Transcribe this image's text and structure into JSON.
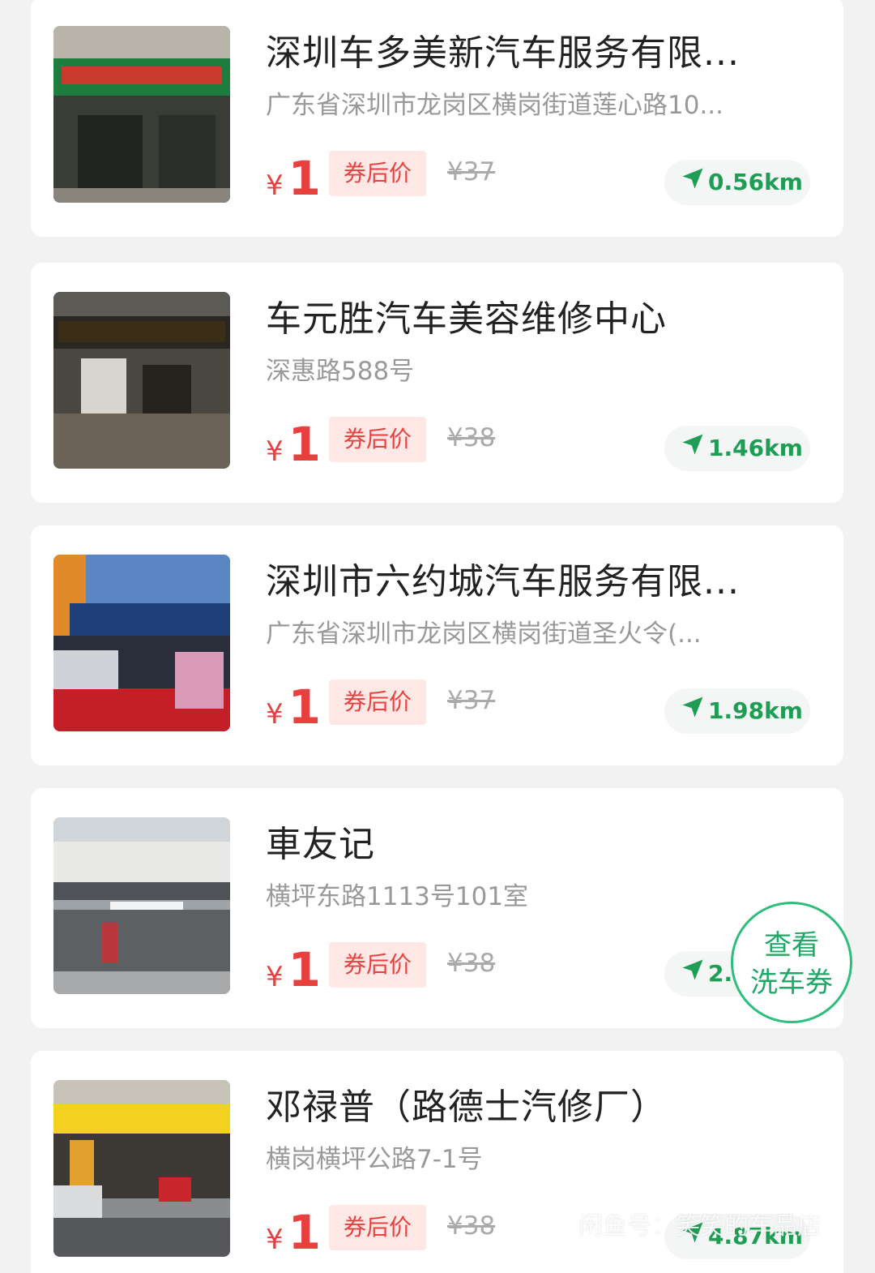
{
  "currency_symbol": "¥",
  "coupon_tag": "券后价",
  "stores": [
    {
      "name": "深圳车多美新汽车服务有限...",
      "address": "广东省深圳市龙岗区横岗街道莲心路10...",
      "price": "1",
      "original_price": "¥37",
      "distance": "0.56km"
    },
    {
      "name": "车元胜汽车美容维修中心",
      "address": "深惠路588号",
      "price": "1",
      "original_price": "¥38",
      "distance": "1.46km"
    },
    {
      "name": "深圳市六约城汽车服务有限...",
      "address": "广东省深圳市龙岗区横岗街道圣火令(...",
      "price": "1",
      "original_price": "¥37",
      "distance": "1.98km"
    },
    {
      "name": "車友记",
      "address": "横坪东路1113号101室",
      "price": "1",
      "original_price": "¥38",
      "distance": "2."
    },
    {
      "name": "邓禄普（路德士汽修厂）",
      "address": "横岗横坪公路7-1号",
      "price": "1",
      "original_price": "¥38",
      "distance": "4.87km"
    }
  ],
  "float_button": {
    "line1": "查看",
    "line2": "洗车券"
  },
  "watermark": {
    "logo": "闲鱼",
    "text": "闲鱼号：笑笑的车品店"
  },
  "colors": {
    "price": "#e8413d",
    "distance": "#1f9d55",
    "accent": "#2ebd7a"
  },
  "icons": {
    "distance": "navigation-arrow-icon"
  }
}
